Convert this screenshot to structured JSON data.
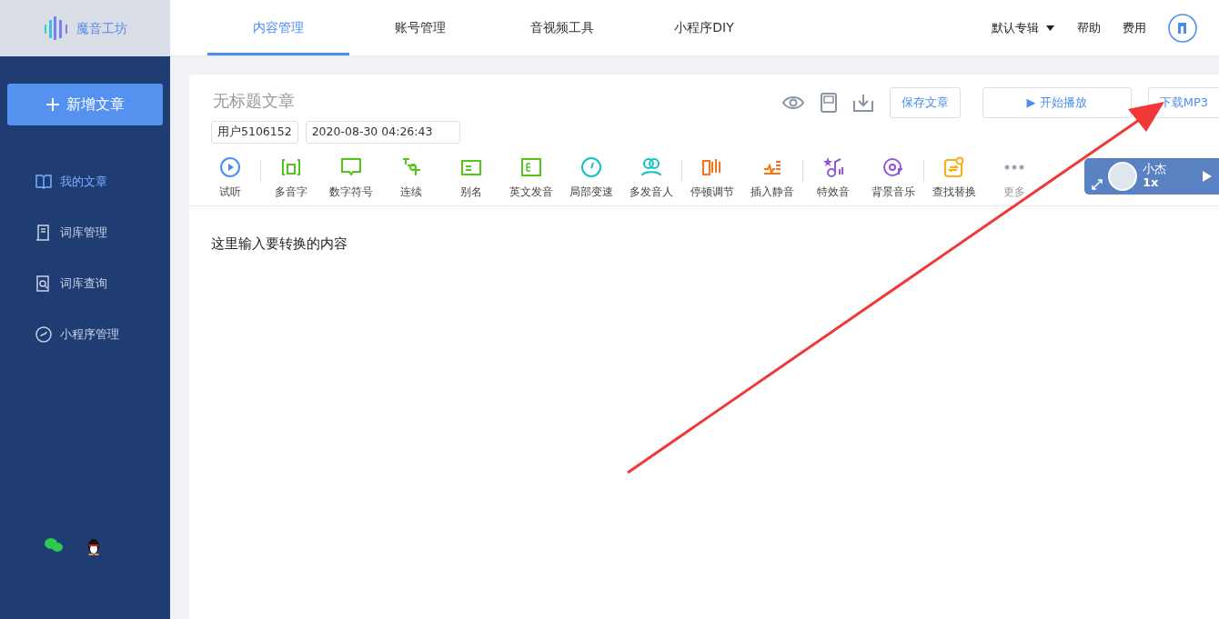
{
  "logo": {
    "text": "魔音工坊"
  },
  "top_nav": [
    {
      "label": "内容管理",
      "selected": true
    },
    {
      "label": "账号管理",
      "selected": false
    },
    {
      "label": "音视频工具",
      "selected": false
    },
    {
      "label": "小程序DIY",
      "selected": false
    }
  ],
  "top_right": {
    "album": "默认专辑",
    "help": "帮助",
    "fee": "费用"
  },
  "sidebar": {
    "new_button": "新增文章",
    "items": [
      {
        "label": "我的文章",
        "selected": true
      },
      {
        "label": "词库管理",
        "selected": false
      },
      {
        "label": "词库查询",
        "selected": false
      },
      {
        "label": "小程序管理",
        "selected": false
      }
    ]
  },
  "article": {
    "title_placeholder": "无标题文章",
    "author": "用户5106152",
    "date": "2020-08-30 04:26:43",
    "save": "保存文章",
    "play": "▶ 开始播放",
    "download": "下载MP3",
    "body_placeholder": "这里输入要转换的内容"
  },
  "toolbar": [
    {
      "label": "试听",
      "color": "#4a8cf0",
      "separator_after": true
    },
    {
      "label": "多音字",
      "color": "#52c41a",
      "separator_after": false
    },
    {
      "label": "数字符号",
      "color": "#52c41a",
      "separator_after": false
    },
    {
      "label": "连续",
      "color": "#52c41a",
      "separator_after": false
    },
    {
      "label": "别名",
      "color": "#52c41a",
      "separator_after": false
    },
    {
      "label": "英文发音",
      "color": "#52c41a",
      "separator_after": false
    },
    {
      "label": "局部变速",
      "color": "#13c2c2",
      "separator_after": false
    },
    {
      "label": "多发音人",
      "color": "#13c2c2",
      "separator_after": true
    },
    {
      "label": "停顿调节",
      "color": "#fa7014",
      "separator_after": false
    },
    {
      "label": "插入静音",
      "color": "#fa7014",
      "separator_after": true
    },
    {
      "label": "特效音",
      "color": "#9254de",
      "separator_after": false
    },
    {
      "label": "背景音乐",
      "color": "#9254de",
      "separator_after": true
    },
    {
      "label": "查找替换",
      "color": "#faad14",
      "separator_after": false
    },
    {
      "label": "更多",
      "color": "#9aa3b0",
      "separator_after": false
    }
  ],
  "speaker": {
    "name": "小杰",
    "speed": "1x"
  }
}
